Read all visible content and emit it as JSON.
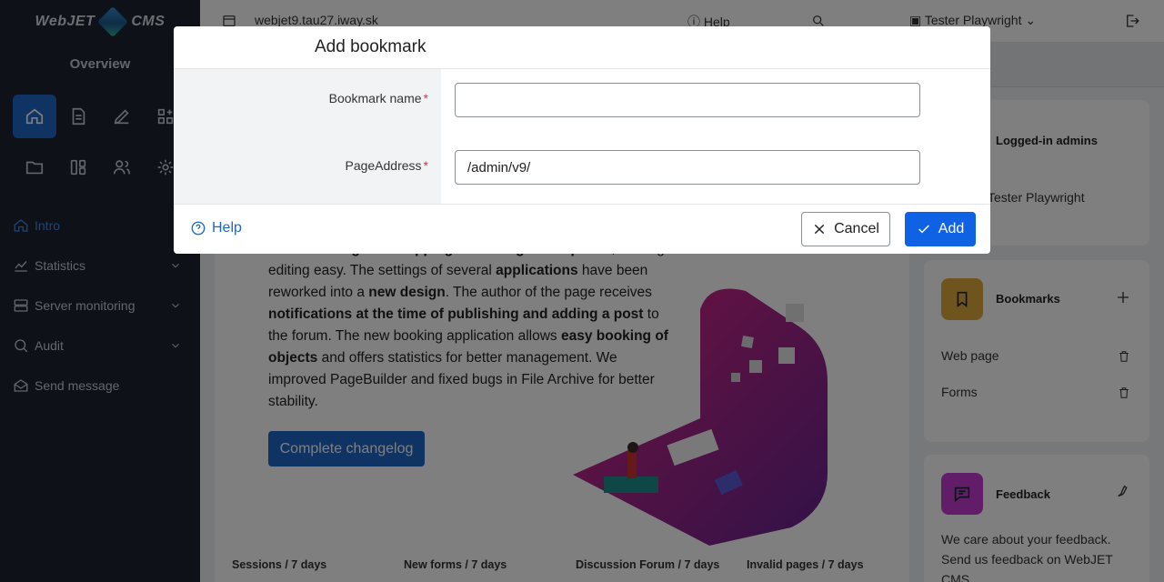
{
  "app": {
    "logo_text_left": "WebJET",
    "logo_text_right": "CMS",
    "overview_label": "Overview"
  },
  "topbar": {
    "domain": "webjet9.tau27.iway.sk",
    "help": "Help",
    "user": "Tester Playwright"
  },
  "sidebar": {
    "nav": [
      {
        "label": "Intro",
        "icon": "home-icon",
        "active": true
      },
      {
        "label": "Statistics",
        "icon": "chart-icon",
        "has_children": true
      },
      {
        "label": "Server monitoring",
        "icon": "server-icon",
        "has_children": true
      },
      {
        "label": "Audit",
        "icon": "audit-icon",
        "has_children": true
      },
      {
        "label": "Send message",
        "icon": "envelope-icon"
      }
    ]
  },
  "main": {
    "article_segments": [
      {
        "t": "some ",
        "b": false
      },
      {
        "t": "resizing and cropping according to templates",
        "b": true
      },
      {
        "t": ", making editing easy. The settings of several ",
        "b": false
      },
      {
        "t": "applications",
        "b": true
      },
      {
        "t": " have been reworked into a ",
        "b": false
      },
      {
        "t": "new design",
        "b": true
      },
      {
        "t": ". The author of the page receives ",
        "b": false
      },
      {
        "t": "notifications at the time of publishing and adding a post",
        "b": true
      },
      {
        "t": " to the forum. The new booking application allows ",
        "b": false
      },
      {
        "t": "easy booking of objects",
        "b": true
      },
      {
        "t": " and offers statistics for better management. We improved PageBuilder and fixed bugs in File Archive for better stability.",
        "b": false
      }
    ],
    "changelog_button": "Complete changelog",
    "stats_labels": [
      "Sessions / 7 days",
      "New forms / 7 days",
      "Discussion Forum / 7 days",
      "Invalid pages / 7 days"
    ]
  },
  "right": {
    "logged_in": {
      "title": "Logged-in admins",
      "user": "Tester Playwright"
    },
    "bookmarks": {
      "title": "Bookmarks",
      "items": [
        "Web page",
        "Forms"
      ],
      "color": "#e0a93a"
    },
    "feedback": {
      "title": "Feedback",
      "text": "We care about your feedback. Send us feedback on WebJET CMS.",
      "color": "#c23ad1"
    }
  },
  "dialog": {
    "title": "Add bookmark",
    "fields": [
      {
        "label": "Bookmark name",
        "required": true,
        "value": "",
        "placeholder": ""
      },
      {
        "label": "PageAddress",
        "required": true,
        "value": "/admin/v9/",
        "placeholder": ""
      }
    ],
    "help": "Help",
    "cancel": "Cancel",
    "add": "Add"
  },
  "colors": {
    "accent": "#1e67c6",
    "sidebar_bg": "#1f2330",
    "required": "#dc3545"
  }
}
